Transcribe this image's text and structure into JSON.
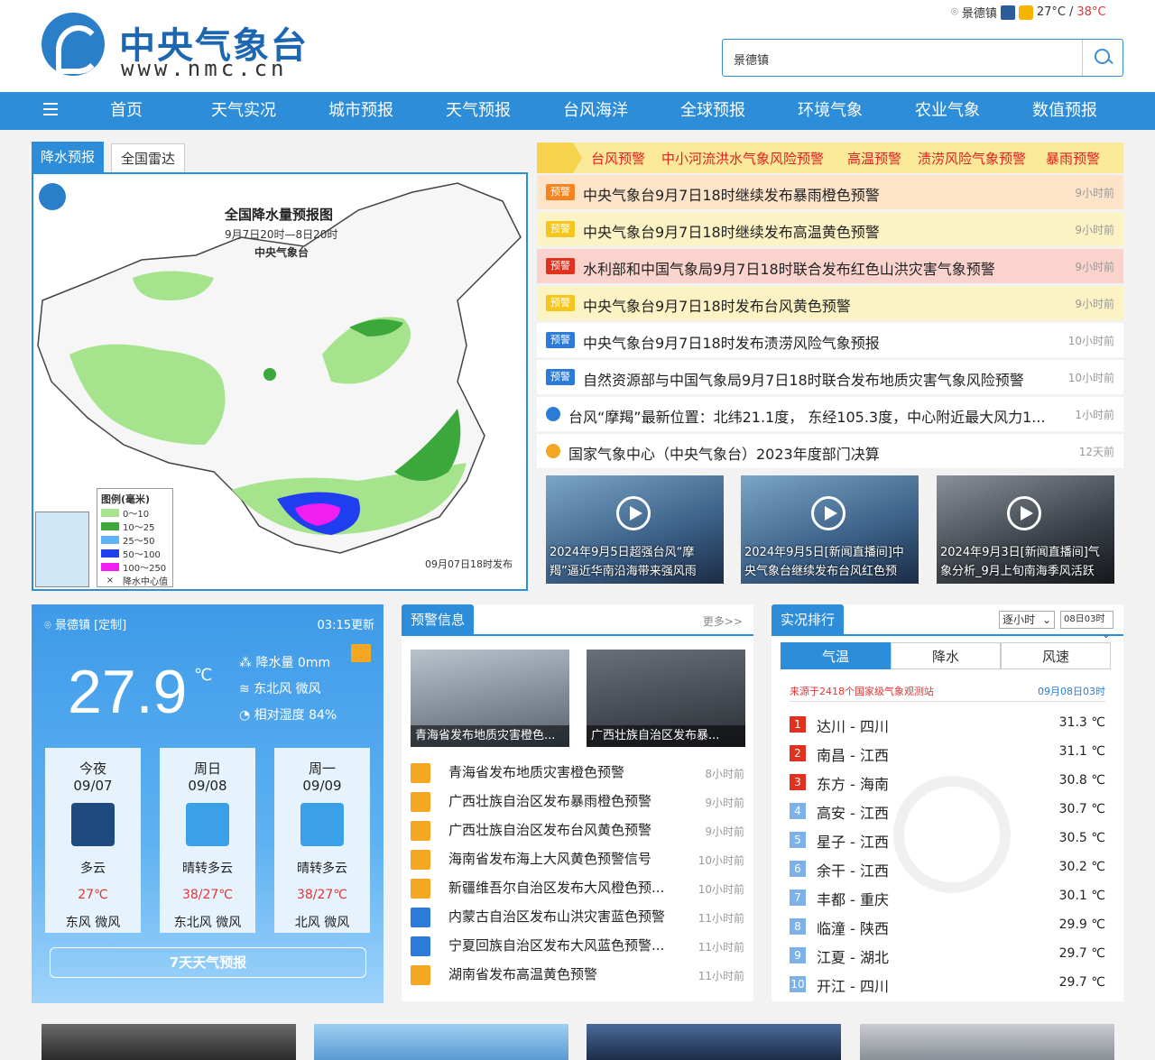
{
  "header": {
    "logo_title": "中央气象台",
    "logo_url": "www.nmc.cn",
    "location": "景德镇",
    "temp_now": "27°C",
    "temp_sep": "/",
    "temp_high": "38°C",
    "search_value": "景德镇"
  },
  "nav": {
    "items": [
      "首页",
      "天气实况",
      "城市预报",
      "天气预报",
      "台风海洋",
      "全球预报",
      "环境气象",
      "农业气象",
      "数值预报"
    ]
  },
  "radar": {
    "tab_active": "降水预报",
    "tab_other": "全国雷达",
    "map_title": "全国降水量预报图",
    "map_sub": "9月7日20时—8日20时",
    "map_org": "中央气象台",
    "legend_title": "图例(毫米)",
    "legend": [
      {
        "label": "0～10",
        "color": "#a5e38c"
      },
      {
        "label": "10～25",
        "color": "#3ca83c"
      },
      {
        "label": "25～50",
        "color": "#5fb3f5"
      },
      {
        "label": "50～100",
        "color": "#1f3ef0"
      },
      {
        "label": "100～250",
        "color": "#f01ef0"
      },
      {
        "label": "降水中心值",
        "color": "#ffffff"
      }
    ],
    "map_date": "09月07日18时发布"
  },
  "warnings": {
    "bar": [
      "台风预警",
      "中小河流洪水气象风险预警",
      "高温预警",
      "渍涝风险气象预警",
      "暴雨预警"
    ],
    "rows": [
      {
        "badge": "预警",
        "text": "中央气象台9月7日18时继续发布暴雨橙色预警",
        "time": "9小时前",
        "bg": "#fde3c8",
        "badge_color": "#f5841f"
      },
      {
        "badge": "预警",
        "text": "中央气象台9月7日18时继续发布高温黄色预警",
        "time": "9小时前",
        "bg": "#fcf3c4",
        "badge_color": "#f5c61f"
      },
      {
        "badge": "预警",
        "text": "水利部和中国气象局9月7日18时联合发布红色山洪灾害气象预警",
        "time": "9小时前",
        "bg": "#fbd3cd",
        "badge_color": "#e0301e"
      },
      {
        "badge": "预警",
        "text": "中央气象台9月7日18时发布台风黄色预警",
        "time": "9小时前",
        "bg": "#fcf3c4",
        "badge_color": "#f5c61f"
      },
      {
        "badge": "预警",
        "text": "中央气象台9月7日18时发布渍涝风险气象预报",
        "time": "10小时前",
        "bg": "#ffffff",
        "badge_color": "#2d7bd8"
      },
      {
        "badge": "预警",
        "text": "自然资源部与中国气象局9月7日18时联合发布地质灾害气象风险预警",
        "time": "10小时前",
        "bg": "#ffffff",
        "badge_color": "#2d7bd8"
      },
      {
        "badge": "",
        "text": "台风“摩羯”最新位置：北纬21.1度， 东经105.3度，中心附近最大风力1...",
        "time": "1小时前",
        "bg": "#ffffff",
        "badge_color": "#2d7bd8"
      },
      {
        "badge": "",
        "text": "国家气象中心（中央气象台）2023年度部门决算",
        "time": "12天前",
        "bg": "#ffffff",
        "badge_color": "#f5a623"
      }
    ]
  },
  "videos": [
    "2024年9月5日超强台风“摩羯”逼近华南沿海带来强风雨",
    "2024年9月5日[新闻直播间]中央气象台继续发布台风红色预",
    "2024年9月3日[新闻直播间]气象分析_9月上旬南海季风活跃"
  ],
  "weather": {
    "location": "景德镇 [定制]",
    "updated": "03:15更新",
    "temp": "27.9",
    "unit": "℃",
    "rain": "降水量 0mm",
    "wind": "东北风 微风",
    "humidity": "相对湿度 84%",
    "days": [
      {
        "name": "今夜",
        "date": "09/07",
        "desc": "多云",
        "temp": "27℃",
        "wind": "东风 微风",
        "icon_color": "#1f4a80"
      },
      {
        "name": "周日",
        "date": "09/08",
        "desc": "晴转多云",
        "temp": "38/27℃",
        "wind": "东北风 微风",
        "icon_color": "#3aa0e8"
      },
      {
        "name": "周一",
        "date": "09/09",
        "desc": "晴转多云",
        "temp": "38/27℃",
        "wind": "北风 微风",
        "icon_color": "#3aa0e8"
      }
    ],
    "button": "7天天气预报"
  },
  "alarm": {
    "title": "预警信息",
    "more": "更多>>",
    "thumbs": [
      "青海省发布地质灾害橙色...",
      "广西壮族自治区发布暴..."
    ],
    "rows": [
      {
        "text": "青海省发布地质灾害橙色预警",
        "time": "8小时前",
        "icon": "orange"
      },
      {
        "text": "广西壮族自治区发布暴雨橙色预警",
        "time": "9小时前",
        "icon": "orange"
      },
      {
        "text": "广西壮族自治区发布台风黄色预警",
        "time": "9小时前",
        "icon": "orange"
      },
      {
        "text": "海南省发布海上大风黄色预警信号",
        "time": "10小时前",
        "icon": "orange"
      },
      {
        "text": "新疆维吾尔自治区发布大风橙色预...",
        "time": "10小时前",
        "icon": "orange"
      },
      {
        "text": "内蒙古自治区发布山洪灾害蓝色预警",
        "time": "11小时前",
        "icon": "blue"
      },
      {
        "text": "宁夏回族自治区发布大风蓝色预警...",
        "time": "11小时前",
        "icon": "blue"
      },
      {
        "text": "湖南省发布高温黄色预警",
        "time": "11小时前",
        "icon": "orange"
      }
    ]
  },
  "ranking": {
    "title": "实况排行",
    "select_period": "逐小时",
    "select_time": "08日03时",
    "tabs": [
      "气温",
      "降水",
      "风速"
    ],
    "source": "来源于2418个国家级气象观测站",
    "time": "09月08日03时",
    "rows": [
      {
        "rank": "1",
        "city": "达川 - 四川",
        "value": "31.3 ℃",
        "color": "#e0301e"
      },
      {
        "rank": "2",
        "city": "南昌 - 江西",
        "value": "31.1 ℃",
        "color": "#e0301e"
      },
      {
        "rank": "3",
        "city": "东方 - 海南",
        "value": "30.8 ℃",
        "color": "#e0301e"
      },
      {
        "rank": "4",
        "city": "高安 - 江西",
        "value": "30.7 ℃",
        "color": "#7cb2e8"
      },
      {
        "rank": "5",
        "city": "星子 - 江西",
        "value": "30.5 ℃",
        "color": "#7cb2e8"
      },
      {
        "rank": "6",
        "city": "余干 - 江西",
        "value": "30.2 ℃",
        "color": "#7cb2e8"
      },
      {
        "rank": "7",
        "city": "丰都 - 重庆",
        "value": "30.1 ℃",
        "color": "#7cb2e8"
      },
      {
        "rank": "8",
        "city": "临潼 - 陕西",
        "value": "29.9 ℃",
        "color": "#7cb2e8"
      },
      {
        "rank": "9",
        "city": "江夏 - 湖北",
        "value": "29.7 ℃",
        "color": "#7cb2e8"
      },
      {
        "rank": "10",
        "city": "开江 - 四川",
        "value": "29.7 ℃",
        "color": "#7cb2e8"
      }
    ]
  }
}
